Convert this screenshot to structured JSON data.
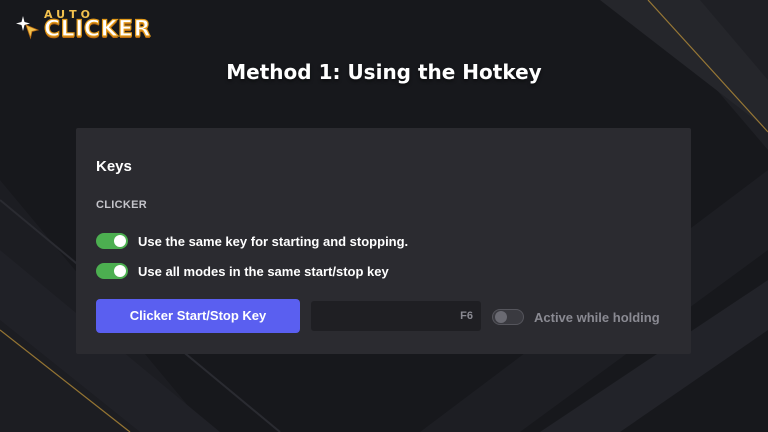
{
  "logo": {
    "line1": "AUTO",
    "line2": "CLICKER",
    "icon": "sparkle-cursor-icon"
  },
  "heading": "Method 1: Using the Hotkey",
  "panel": {
    "title": "Keys",
    "section_label": "CLICKER",
    "toggles": [
      {
        "label": "Use the same key for starting and stopping.",
        "state": "on"
      },
      {
        "label": "Use all modes in the same start/stop key",
        "state": "on"
      }
    ],
    "start_stop_button": "Clicker Start/Stop Key",
    "key_value": "F6",
    "active_while_holding": {
      "label": "Active while holding",
      "state": "off"
    }
  },
  "colors": {
    "background": "#16171b",
    "panel": "#2b2b30",
    "accent_button": "#5a5ff0",
    "toggle_on": "#4caf50",
    "logo_gold": "#f2c14e"
  }
}
